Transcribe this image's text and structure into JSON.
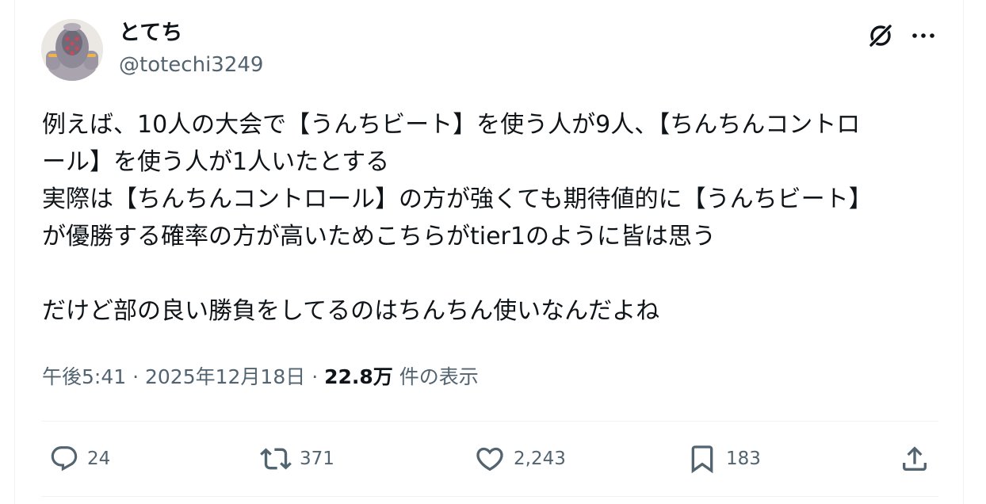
{
  "user": {
    "display_name": "とてち",
    "handle": "@totechi3249"
  },
  "tweet": {
    "lines": [
      "例えば、10人の大会で【うんちビート】を使う人が9人、【ちんちんコントロ",
      "ール】を使う人が1人いたとする",
      "実際は【ちんちんコントロール】の方が強くても期待値的に【うんちビート】",
      "が優勝する確率の方が高いためこちらがtier1のように皆は思う"
    ],
    "closing_line": "だけど部の良い勝負をしてるのはちんちん使いなんだよね"
  },
  "meta": {
    "time": "午後5:41",
    "separator": "·",
    "date": "2025年12月18日",
    "views_count": "22.8万",
    "views_label": "件の表示"
  },
  "actions": {
    "replies": "24",
    "reposts": "371",
    "likes": "2,243",
    "bookmarks": "183"
  },
  "icons": {
    "header": [
      "grok-icon",
      "more-icon"
    ],
    "actions": [
      "reply-icon",
      "repost-icon",
      "like-icon",
      "bookmark-icon",
      "share-icon"
    ]
  },
  "colors": {
    "text_primary": "#0f1419",
    "text_secondary": "#536471",
    "divider": "#eff3f4"
  }
}
